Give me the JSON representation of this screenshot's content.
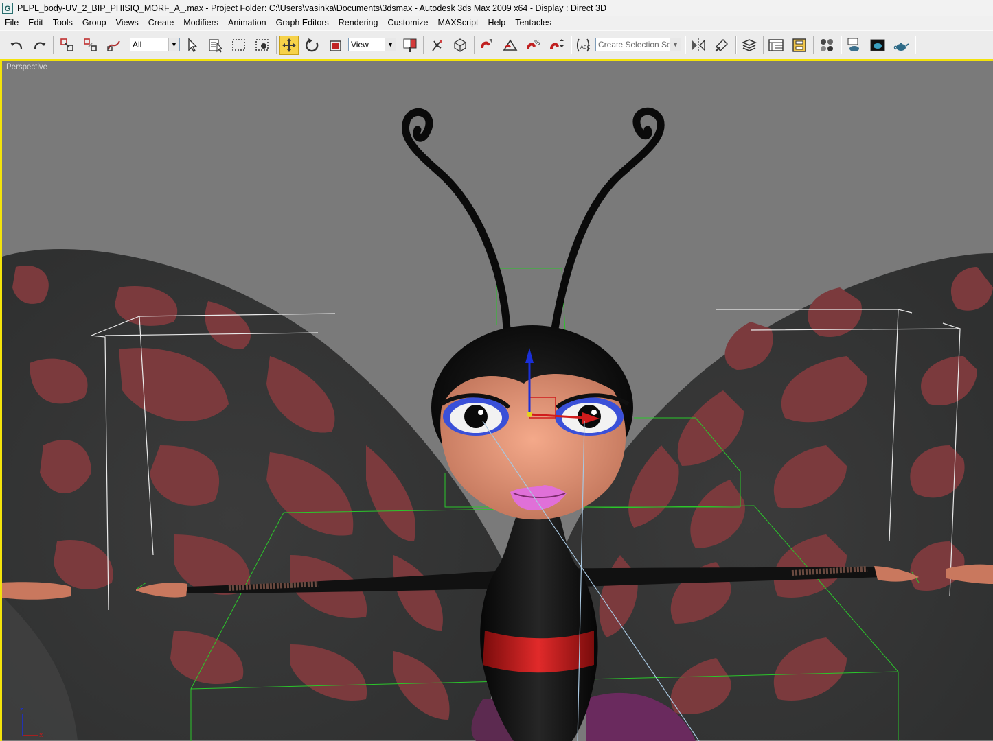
{
  "window": {
    "title": "PEPL_body-UV_2_BIP_PHISIQ_MORF_A_.max      - Project Folder: C:\\Users\\vasinka\\Documents\\3dsmax      - Autodesk 3ds Max  2009 x64       - Display : Direct 3D"
  },
  "menu": [
    "File",
    "Edit",
    "Tools",
    "Group",
    "Views",
    "Create",
    "Modifiers",
    "Animation",
    "Graph Editors",
    "Rendering",
    "Customize",
    "MAXScript",
    "Help",
    "Tentacles"
  ],
  "toolbar": {
    "selection_filter": "All",
    "reference_coord": "View",
    "named_selection_placeholder": "Create Selection Set",
    "active_tool": "select-and-move"
  },
  "viewport": {
    "label": "Perspective",
    "axis_labels": {
      "z": "z",
      "x": "x"
    },
    "active_border_color": "#f3e30b",
    "background_color": "#7a7a7a"
  }
}
